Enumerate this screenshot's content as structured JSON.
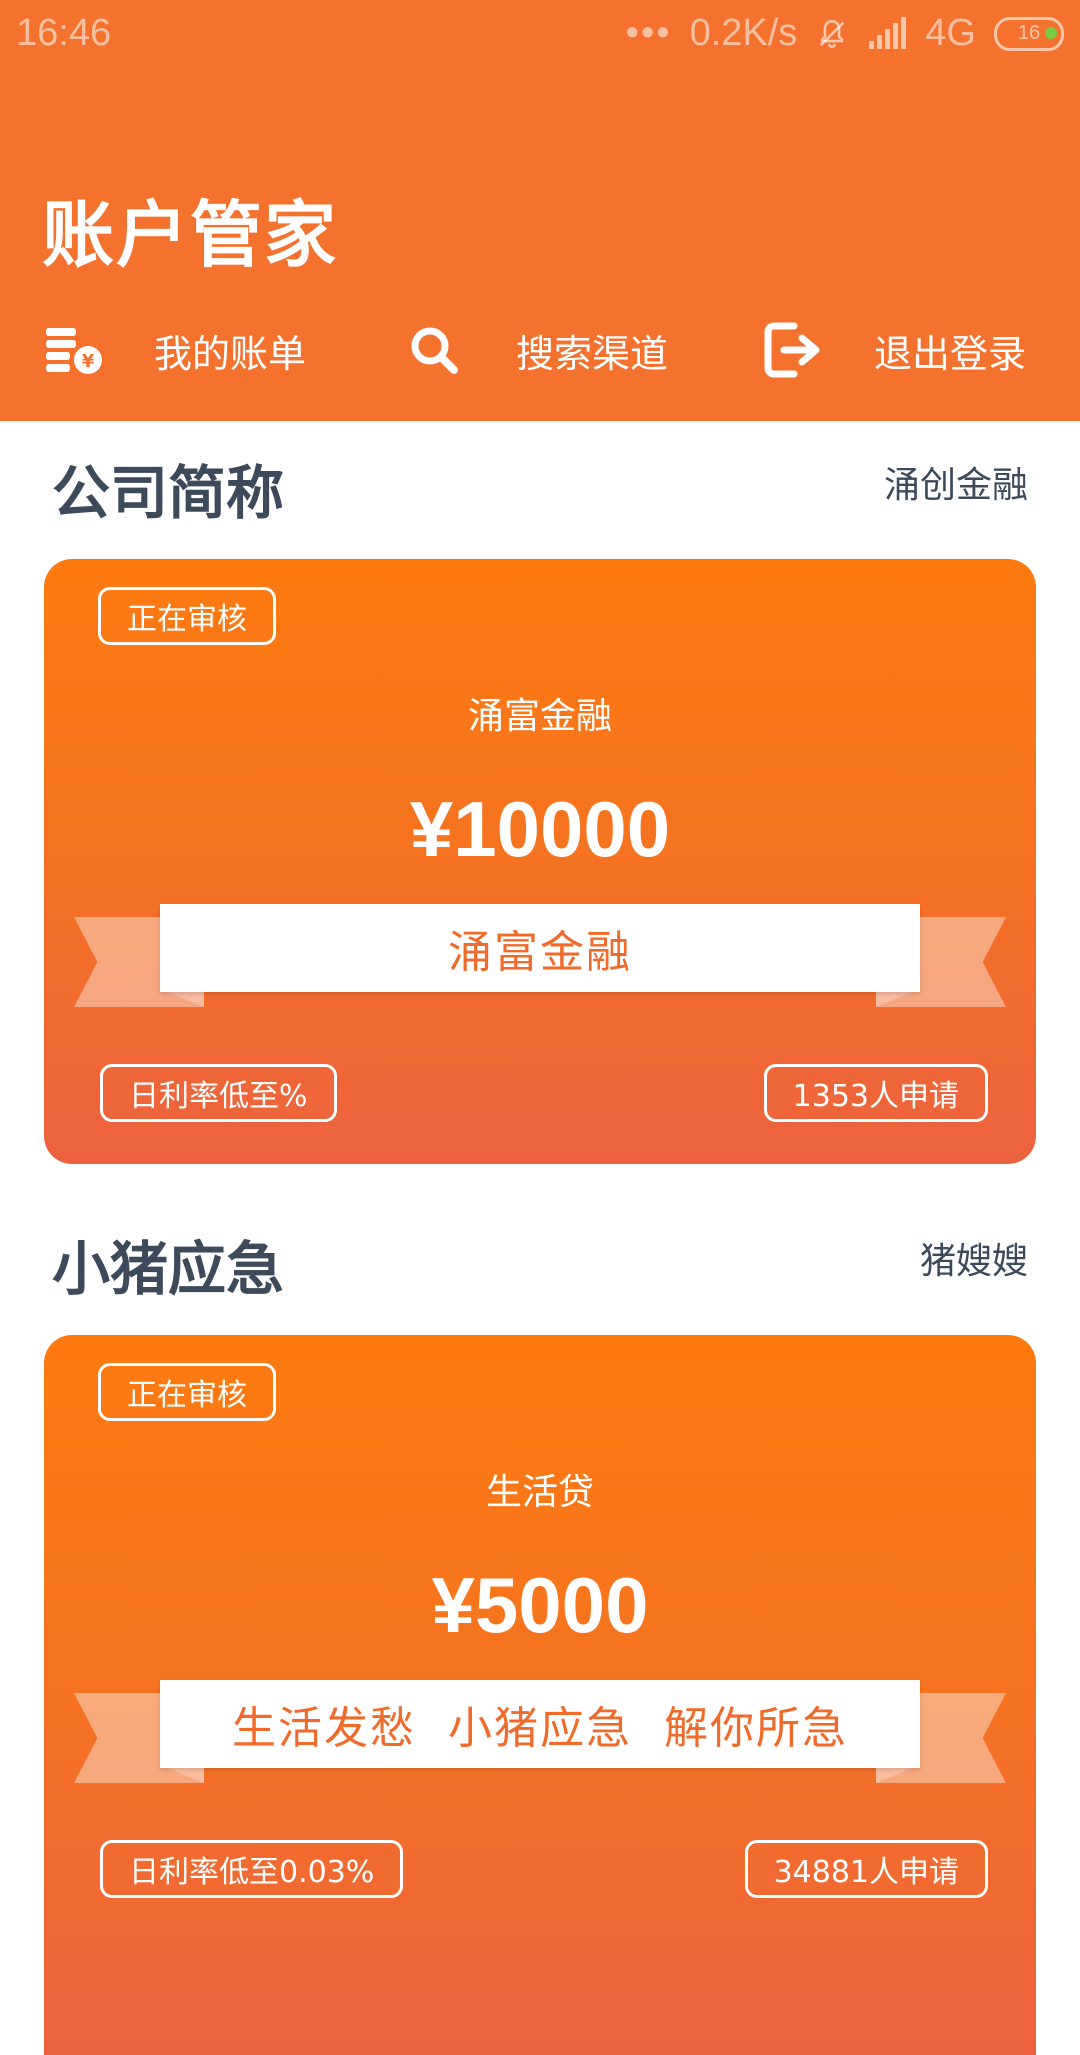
{
  "statusbar": {
    "time": "16:46",
    "dots": "•••",
    "speed": "0.2K/s",
    "network": "4G",
    "battery": "16"
  },
  "app": {
    "title": "账户管家"
  },
  "nav": {
    "bill": {
      "label": "我的账单",
      "icon": "bill-icon"
    },
    "search": {
      "label": "搜索渠道",
      "icon": "search-icon"
    },
    "logout": {
      "label": "退出登录",
      "icon": "logout-icon"
    }
  },
  "colors": {
    "header": "#F4722E",
    "card_top": "#FE7A10",
    "card_bottom": "#EC6240",
    "section_text": "#3D4A5C",
    "ribbon_text": "#F06A2A"
  },
  "sections": [
    {
      "title": "公司简称",
      "right": "涌创金融",
      "card": {
        "status": "正在审核",
        "product": "涌富金融",
        "amount": "¥10000",
        "slogan": "涌富金融",
        "rate": "日利率低至%",
        "applicants": "1353人申请"
      }
    },
    {
      "title": "小猪应急",
      "right": "猪嫂嫂",
      "card": {
        "status": "正在审核",
        "product": "生活贷",
        "amount": "¥5000",
        "slogan": "生活发愁  小猪应急  解你所急",
        "rate": "日利率低至0.03%",
        "applicants": "34881人申请"
      }
    }
  ]
}
